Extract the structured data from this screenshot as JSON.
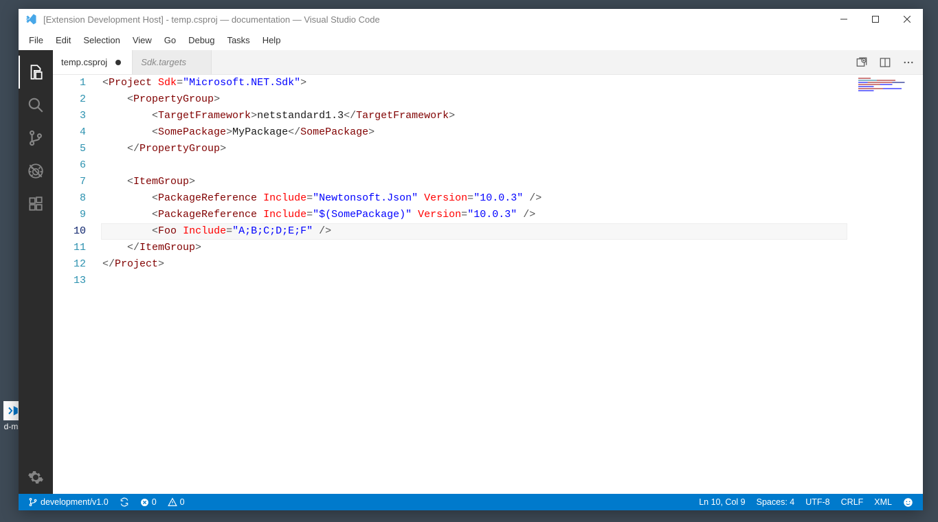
{
  "window_title": "[Extension Development Host] - temp.csproj — documentation — Visual Studio Code",
  "menu": [
    "File",
    "Edit",
    "Selection",
    "View",
    "Go",
    "Debug",
    "Tasks",
    "Help"
  ],
  "tabs": [
    {
      "label": "temp.csproj",
      "active": true,
      "dirty": true
    },
    {
      "label": "Sdk.targets",
      "active": false,
      "dirty": false
    }
  ],
  "activitybar": [
    {
      "name": "explorer-icon",
      "active": true
    },
    {
      "name": "search-icon",
      "active": false
    },
    {
      "name": "source-control-icon",
      "active": false
    },
    {
      "name": "debug-icon",
      "active": false
    },
    {
      "name": "extensions-icon",
      "active": false
    }
  ],
  "line_count": 13,
  "current_line": 10,
  "code": {
    "l1": {
      "i": 0,
      "t": [
        [
          "p",
          "<"
        ],
        [
          "tg",
          "Project"
        ],
        [
          "p",
          " "
        ],
        [
          "at",
          "Sdk"
        ],
        [
          "p",
          "="
        ],
        [
          "st",
          "\"Microsoft.NET.Sdk\""
        ],
        [
          "p",
          ">"
        ]
      ]
    },
    "l2": {
      "i": 1,
      "t": [
        [
          "p",
          "<"
        ],
        [
          "tg",
          "PropertyGroup"
        ],
        [
          "p",
          ">"
        ]
      ]
    },
    "l3": {
      "i": 2,
      "t": [
        [
          "p",
          "<"
        ],
        [
          "tg",
          "TargetFramework"
        ],
        [
          "p",
          ">"
        ],
        [
          "tx",
          "netstandard1.3"
        ],
        [
          "p",
          "</"
        ],
        [
          "tg",
          "TargetFramework"
        ],
        [
          "p",
          ">"
        ]
      ]
    },
    "l4": {
      "i": 2,
      "t": [
        [
          "p",
          "<"
        ],
        [
          "tg",
          "SomePackage"
        ],
        [
          "p",
          ">"
        ],
        [
          "tx",
          "MyPackage"
        ],
        [
          "p",
          "</"
        ],
        [
          "tg",
          "SomePackage"
        ],
        [
          "p",
          ">"
        ]
      ]
    },
    "l5": {
      "i": 1,
      "t": [
        [
          "p",
          "</"
        ],
        [
          "tg",
          "PropertyGroup"
        ],
        [
          "p",
          ">"
        ]
      ]
    },
    "l6": {
      "i": 0,
      "t": []
    },
    "l7": {
      "i": 1,
      "t": [
        [
          "p",
          "<"
        ],
        [
          "tg",
          "ItemGroup"
        ],
        [
          "p",
          ">"
        ]
      ]
    },
    "l8": {
      "i": 2,
      "t": [
        [
          "p",
          "<"
        ],
        [
          "tg",
          "PackageReference"
        ],
        [
          "p",
          " "
        ],
        [
          "at",
          "Include"
        ],
        [
          "p",
          "="
        ],
        [
          "st",
          "\"Newtonsoft.Json\""
        ],
        [
          "p",
          " "
        ],
        [
          "at",
          "Version"
        ],
        [
          "p",
          "="
        ],
        [
          "st",
          "\"10.0.3\""
        ],
        [
          "p",
          " />"
        ]
      ]
    },
    "l9": {
      "i": 2,
      "t": [
        [
          "p",
          "<"
        ],
        [
          "tg",
          "PackageReference"
        ],
        [
          "p",
          " "
        ],
        [
          "at",
          "Include"
        ],
        [
          "p",
          "="
        ],
        [
          "st",
          "\"$(SomePackage)\""
        ],
        [
          "p",
          " "
        ],
        [
          "at",
          "Version"
        ],
        [
          "p",
          "="
        ],
        [
          "st",
          "\"10.0.3\""
        ],
        [
          "p",
          " />"
        ]
      ]
    },
    "l10": {
      "i": 2,
      "t": [
        [
          "p",
          "<"
        ],
        [
          "tg",
          "Foo"
        ],
        [
          "p",
          " "
        ],
        [
          "at",
          "Include"
        ],
        [
          "p",
          "="
        ],
        [
          "st",
          "\"A;B;C;D;E;F\""
        ],
        [
          "p",
          " />"
        ]
      ]
    },
    "l11": {
      "i": 1,
      "t": [
        [
          "p",
          "</"
        ],
        [
          "tg",
          "ItemGroup"
        ],
        [
          "p",
          ">"
        ]
      ]
    },
    "l12": {
      "i": 0,
      "t": [
        [
          "p",
          "</"
        ],
        [
          "tg",
          "Project"
        ],
        [
          "p",
          ">"
        ]
      ]
    },
    "l13": {
      "i": 0,
      "t": []
    }
  },
  "status": {
    "branch": "development/v1.0",
    "sync": "",
    "errors": "0",
    "warnings": "0",
    "ln_col": "Ln 10, Col 9",
    "spaces": "Spaces: 4",
    "encoding": "UTF-8",
    "eol": "CRLF",
    "language": "XML"
  },
  "desktop_icon_label": "d-ms"
}
